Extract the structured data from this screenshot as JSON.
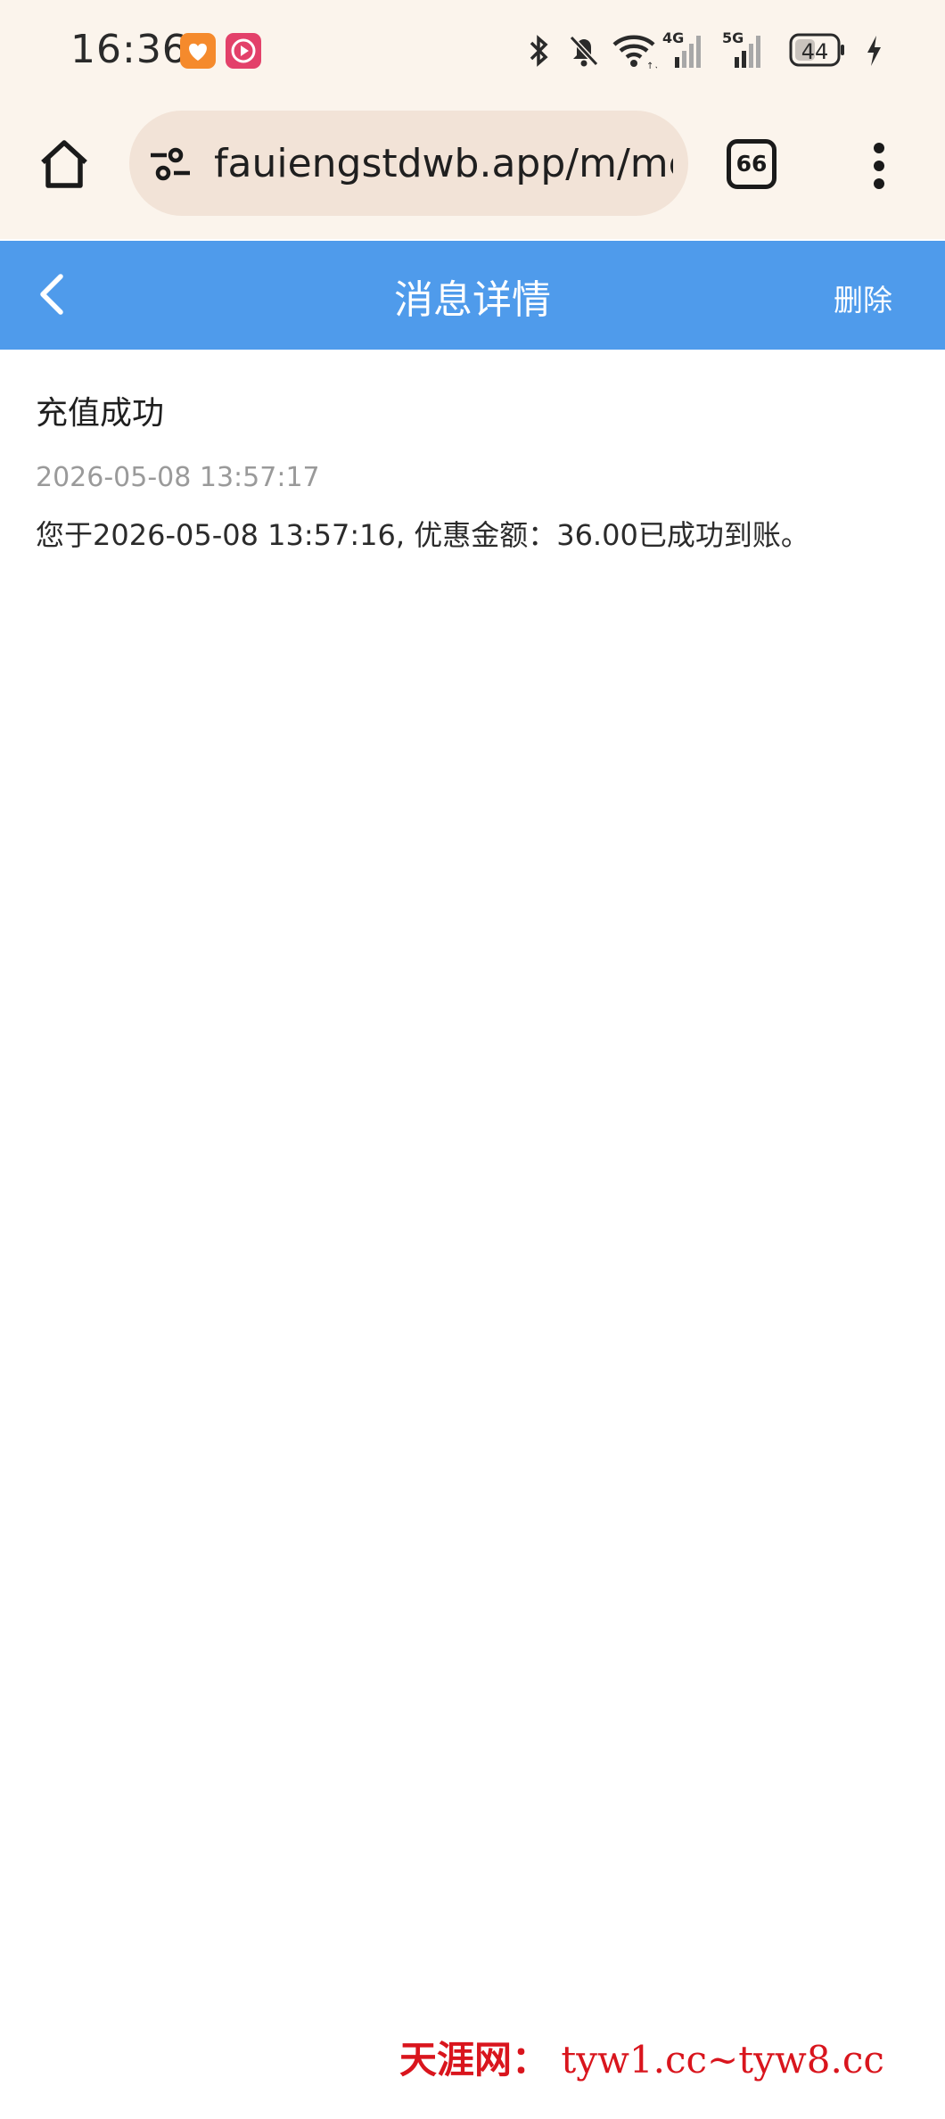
{
  "status_bar": {
    "time": "16:36",
    "battery": "44",
    "network_1": "4G",
    "network_2": "5G",
    "icons": [
      "heart-app-icon",
      "video-app-icon",
      "bluetooth-icon",
      "mute-icon",
      "wifi-icon",
      "signal-icon",
      "battery-icon",
      "charging-icon"
    ]
  },
  "browser": {
    "url": "fauiengstdwb.app/m/me",
    "tab_count": "66",
    "icons": [
      "home-icon",
      "site-settings-icon",
      "tabs-icon",
      "more-menu-icon"
    ]
  },
  "header": {
    "title": "消息详情",
    "delete_label": "删除",
    "back_icon": "chevron-left-icon",
    "color": "#4f9beb"
  },
  "message": {
    "title": "充值成功",
    "timestamp": "2026-05-08 13:57:17",
    "body": "您于2026-05-08 13:57:16, 优惠金额：36.00已成功到账。"
  },
  "watermark": {
    "label": "天涯网：",
    "domains": "tyw1.cc~tyw8.cc"
  }
}
